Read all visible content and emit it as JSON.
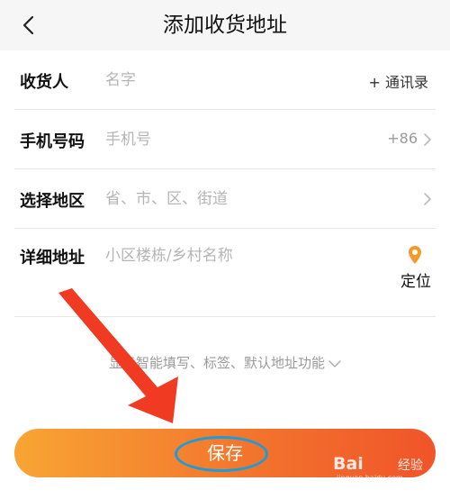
{
  "header": {
    "title": "添加收货地址",
    "back_icon": "chevron-left-icon"
  },
  "form": {
    "recipient": {
      "label": "收货人",
      "placeholder": "名字",
      "action": "+ 通讯录"
    },
    "phone": {
      "label": "手机号码",
      "placeholder": "手机号",
      "country_code": "+86"
    },
    "region": {
      "label": "选择地区",
      "placeholder": "省、市、区、街道"
    },
    "address": {
      "label": "详细地址",
      "placeholder": "小区楼栋/乡村名称",
      "locate_label": "定位",
      "locate_icon": "location-pin-icon"
    }
  },
  "more_options": "显示智能填写、标签、默认地址功能",
  "save_button": {
    "label": "保存"
  },
  "watermark": {
    "logo": "Bai",
    "text": "经验",
    "url": "jingyan.baidu.com"
  },
  "colors": {
    "accent": "#f37a2d",
    "pin": "#f39a2b",
    "arrow": "#f03a22",
    "highlight_ring": "#1e9bd9",
    "button_start": "#f8a534",
    "button_end": "#f0542a"
  }
}
